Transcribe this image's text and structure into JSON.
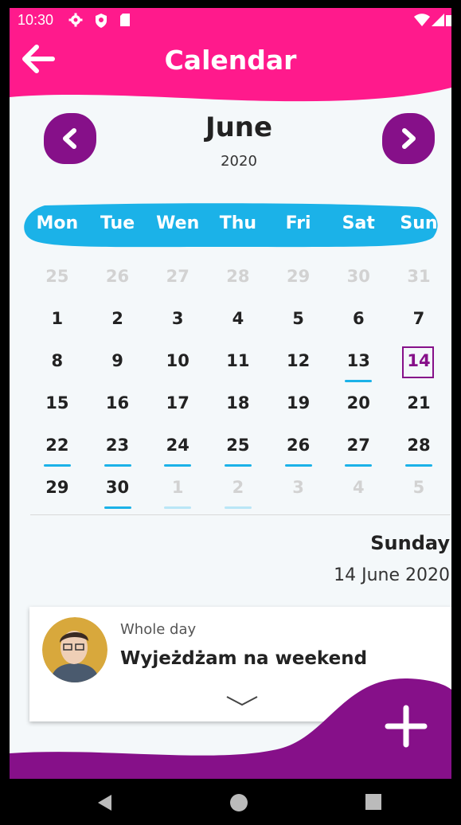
{
  "status_bar": {
    "time": "10:30"
  },
  "header": {
    "title": "Calendar"
  },
  "calendar": {
    "month": "June",
    "year": "2020",
    "weekdays": [
      "Mon",
      "Tue",
      "Wen",
      "Thu",
      "Fri",
      "Sat",
      "Sun"
    ],
    "weeks": [
      [
        "25",
        "26",
        "27",
        "28",
        "29",
        "30",
        "31"
      ],
      [
        "1",
        "2",
        "3",
        "4",
        "5",
        "6",
        "7"
      ],
      [
        "8",
        "9",
        "10",
        "11",
        "12",
        "13",
        "14"
      ],
      [
        "15",
        "16",
        "17",
        "18",
        "19",
        "20",
        "21"
      ],
      [
        "22",
        "23",
        "24",
        "25",
        "26",
        "27",
        "28"
      ],
      [
        "29",
        "30",
        "1",
        "2",
        "3",
        "4",
        "5"
      ]
    ]
  },
  "selected_day": {
    "weekday": "Sunday",
    "date": "14 June 2020"
  },
  "event": {
    "time_label": "Whole day",
    "title": "Wyjeżdżam na weekend"
  },
  "colors": {
    "header": "#ff1a8c",
    "accent": "#861089",
    "weekbar": "#1bb2e8",
    "event_marker": "#1bb2e8"
  }
}
